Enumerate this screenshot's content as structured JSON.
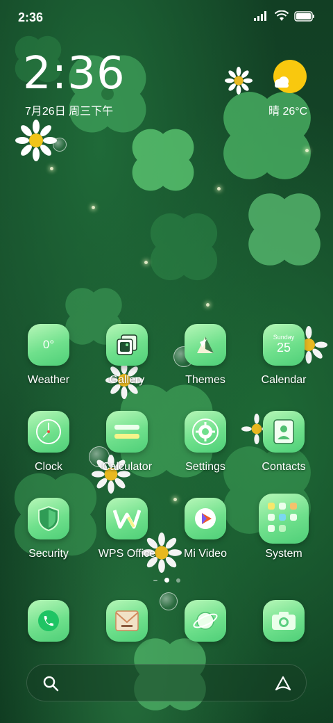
{
  "status_bar": {
    "time": "2:36",
    "icons": [
      "signal-icon",
      "wifi-icon",
      "battery-icon"
    ]
  },
  "clock_widget": {
    "time": "2:36",
    "date": "7月26日 周三下午"
  },
  "weather_widget": {
    "condition_icon": "partly-sunny-icon",
    "text": "晴 26°C"
  },
  "calendar_icon": {
    "day_name": "Sunday",
    "day_number": "25"
  },
  "weather_icon_text": "0°",
  "apps": [
    {
      "label": "Weather"
    },
    {
      "label": "Gallery"
    },
    {
      "label": "Themes"
    },
    {
      "label": "Calendar"
    },
    {
      "label": "Clock"
    },
    {
      "label": "Calculator"
    },
    {
      "label": "Settings"
    },
    {
      "label": "Contacts"
    },
    {
      "label": "Security"
    },
    {
      "label": "WPS Office"
    },
    {
      "label": "Mi Video"
    },
    {
      "label": "System"
    }
  ],
  "dock": [
    "phone-icon",
    "messages-icon",
    "browser-icon",
    "camera-icon"
  ],
  "page_indicator": {
    "pages": 3,
    "active": 2
  },
  "search_bar": {
    "left_icon": "search-icon",
    "right_icon": "assistant-icon"
  },
  "colors": {
    "icon_green": "#6fe08c",
    "sun_yellow": "#f9c80e",
    "wallpaper_green": "#164a2a"
  }
}
